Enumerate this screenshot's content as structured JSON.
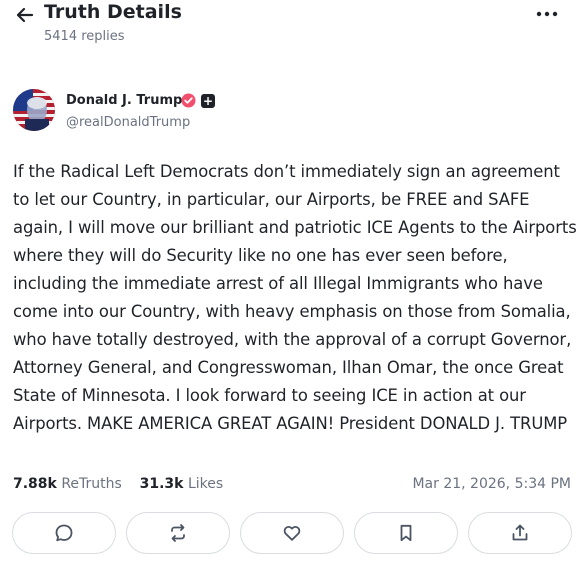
{
  "header": {
    "title": "Truth Details",
    "replies": "5414 replies",
    "back_icon": "arrow-left-icon",
    "more_icon": "more-horizontal-icon"
  },
  "post": {
    "author_name": "Donald J. Trump",
    "handle": "@realDonaldTrump",
    "verified_color": "#f0506e",
    "text": "If the Radical Left Democrats don’t immediately sign an agreement to let our Country, in particular, our Airports, be FREE and SAFE again, I will move our brilliant and patriotic ICE Agents to the Airports where they will do Security like no one has ever seen before, including the immediate arrest of all Illegal Immigrants who have come into our Country, with heavy emphasis on those from Somalia, who have totally destroyed, with the approval of a corrupt Governor, Attorney General, and Congresswoman, Ilhan Omar, the once Great State of Minnesota. I look forward to seeing ICE in action at our Airports. MAKE AMERICA GREAT AGAIN! President DONALD J. TRUMP",
    "retruths_count": "7.88k",
    "retruths_label": "ReTruths",
    "likes_count": "31.3k",
    "likes_label": "Likes",
    "timestamp": "Mar 21, 2026, 5:34 PM"
  },
  "actions": [
    {
      "icon": "reply-icon"
    },
    {
      "icon": "retruth-icon"
    },
    {
      "icon": "heart-icon"
    },
    {
      "icon": "bookmark-icon"
    },
    {
      "icon": "share-icon"
    }
  ]
}
